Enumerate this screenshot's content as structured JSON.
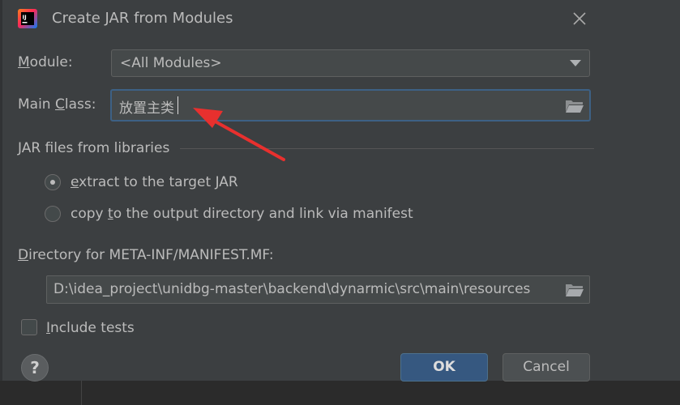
{
  "dialog": {
    "title": "Create JAR from Modules",
    "app_icon": "intellij-idea-icon",
    "close_icon": "close-icon"
  },
  "module": {
    "label_hotkey": "M",
    "label_rest": "odule:",
    "value": "<All Modules>"
  },
  "main_class": {
    "label_pre": "Main ",
    "label_hotkey": "C",
    "label_post": "lass:",
    "value": "放置主类"
  },
  "libraries": {
    "section_label": "JAR files from libraries",
    "options": [
      {
        "hotkey": "e",
        "rest": "xtract to the target JAR",
        "selected": true
      },
      {
        "pre": "copy ",
        "hotkey": "t",
        "rest": "o the output directory and link via manifest",
        "selected": false
      }
    ]
  },
  "manifest": {
    "label_hotkey": "D",
    "label_rest": "irectory for META-INF/MANIFEST.MF:",
    "value": "D:\\idea_project\\unidbg-master\\backend\\dynarmic\\src\\main\\resources"
  },
  "include_tests": {
    "label_hotkey": "I",
    "label_rest": "nclude tests",
    "checked": false
  },
  "buttons": {
    "help": "?",
    "ok": "OK",
    "cancel": "Cancel"
  },
  "colors": {
    "dialog_bg": "#3c3f41",
    "field_bg": "#45494a",
    "focus_border": "#3d6185",
    "ok_bg": "#365880",
    "annotation_arrow": "#e8302e"
  },
  "annotation": {
    "type": "red-arrow",
    "points_to": "main-class-input"
  }
}
